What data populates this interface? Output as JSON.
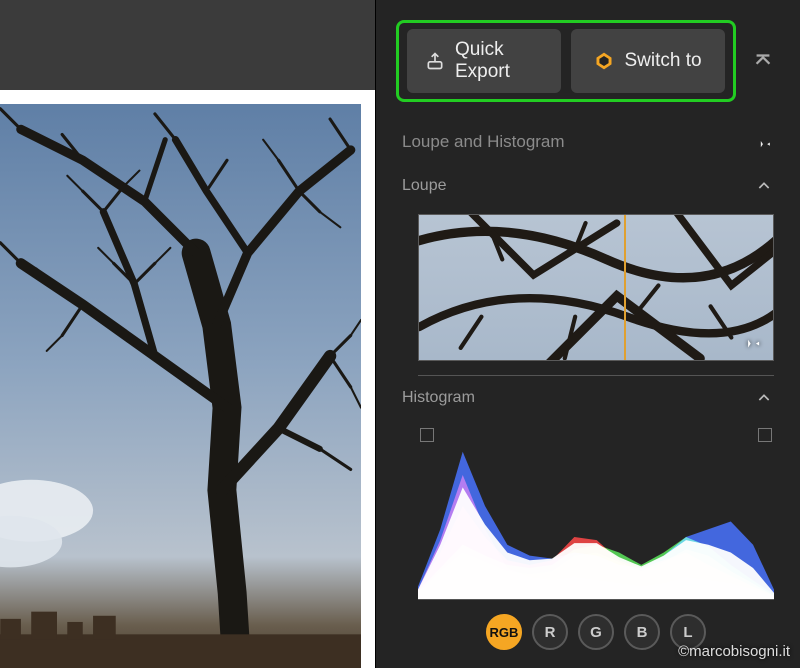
{
  "toolbar": {
    "quick_export": "Quick Export",
    "switch_to": "Switch to"
  },
  "panel": {
    "title": "Loupe and Histogram",
    "loupe_label": "Loupe",
    "histogram_label": "Histogram"
  },
  "channels": {
    "rgb": "RGB",
    "r": "R",
    "g": "G",
    "b": "B",
    "l": "L",
    "active": "rgb"
  },
  "watermark": "©marcobisogni.it",
  "colors": {
    "highlight_border": "#22cc22",
    "channel_active_bg": "#f5a623",
    "crosshair": "#e0a030"
  },
  "chart_data": {
    "type": "area",
    "title": "Histogram",
    "xlabel": "",
    "ylabel": "",
    "x": [
      0,
      16,
      32,
      48,
      64,
      80,
      96,
      112,
      128,
      144,
      160,
      176,
      192,
      208,
      224,
      240,
      255
    ],
    "ylim": [
      0,
      100
    ],
    "series": [
      {
        "name": "Red",
        "color": "#ff2a2a",
        "values": [
          5,
          30,
          60,
          40,
          25,
          22,
          25,
          40,
          38,
          25,
          20,
          25,
          30,
          22,
          15,
          8,
          2
        ]
      },
      {
        "name": "Green",
        "color": "#40e040",
        "values": [
          5,
          20,
          35,
          28,
          22,
          20,
          22,
          32,
          35,
          30,
          22,
          30,
          40,
          34,
          22,
          12,
          3
        ]
      },
      {
        "name": "Blue",
        "color": "#2a5cff",
        "values": [
          8,
          45,
          95,
          60,
          35,
          28,
          26,
          30,
          28,
          22,
          20,
          28,
          40,
          45,
          50,
          35,
          6
        ]
      },
      {
        "name": "Luma",
        "color": "#ffffff",
        "values": [
          6,
          35,
          72,
          48,
          30,
          25,
          26,
          36,
          36,
          27,
          21,
          28,
          38,
          35,
          30,
          20,
          4
        ]
      }
    ]
  }
}
